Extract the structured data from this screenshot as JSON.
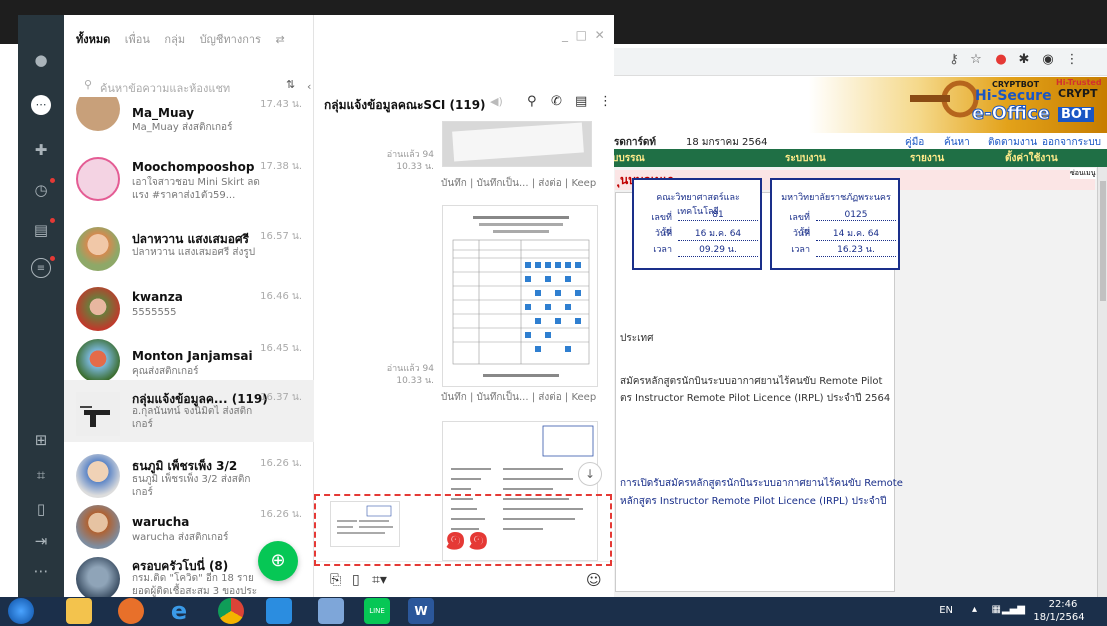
{
  "browser": {
    "banner": {
      "cryptbot": "CRYPTBOT",
      "hi_trusted": "Hi-Trusted",
      "crypt": "CRYPT",
      "hi_secure": "Hi-Secure",
      "eoffice": "e-Office",
      "bot": "BOT"
    },
    "info_bar": {
      "page": "รดการ์ดท์",
      "date": "18 มกราคม 2564",
      "help": "คู่มือ",
      "search": "ค้นหา",
      "track": "ติดตามงาน",
      "logout": "ออกจากระบบ"
    },
    "menu": [
      "บบรรณ",
      "ระบบงาน",
      "รายงาน",
      "ตั้งค่าใช้งาน"
    ],
    "menu_hide": "ซ่อนเมนู",
    "page_title": "ุนบบลูเนเา",
    "stamp_left": {
      "title": "คณะวิทยาศาสตร์และเทคโนโลยี",
      "no_label": "เลขที่รับ",
      "no": "81",
      "date_label": "วันที่",
      "date": "16 ม.ค. 64",
      "time_label": "เวลา",
      "time": "09.29 น."
    },
    "stamp_right": {
      "title": "มหาวิทยาลัยราชภัฏพระนคร",
      "no_label": "เลขที่รับ",
      "no": "0125",
      "date_label": "วันที่",
      "date": "14 ม.ค. 64",
      "time_label": "เวลา",
      "time": "16.23 น."
    },
    "doc_lines": [
      "ประเทศ",
      "สมัครหลักสูตรนักบินระบบอากาศยานไร้คนขับ Remote Pilot",
      "ตร Instructor Remote Pilot Licence (IRPL) ประจำปี 2564",
      "การเปิดรับสมัครหลักสูตรนักบินระบบอากาศยานไร้คนขับ Remote",
      "หลักสูตร Instructor Remote Pilot Licence (IRPL) ประจำปี"
    ]
  },
  "line": {
    "tabs": [
      "ทั้งหมด",
      "เพื่อน",
      "กลุ่ม",
      "บัญชีทางการ"
    ],
    "search_placeholder": "ค้นหาข้อความและห้องแชท",
    "chats": [
      {
        "name": "Ma_Muay",
        "preview": "Ma_Muay ส่งสติกเกอร์",
        "time": "17.43 น."
      },
      {
        "name": "Moochompooshop",
        "preview": "เอาใจสาวชอบ Mini Skirt ลดแรง #ราคาส่ง1ตัว59...",
        "time": "17.38 น."
      },
      {
        "name": "ปลาหวาน แสงเสมอศรี",
        "preview": "ปลาหวาน แสงเสมอศรี ส่งรูป",
        "time": "16.57 น."
      },
      {
        "name": "kwanza",
        "preview": "5555555",
        "time": "16.46 น."
      },
      {
        "name": "Monton Janjamsai",
        "preview": "คุณส่งสติกเกอร์",
        "time": "16.45 น."
      },
      {
        "name": "กลุ่มแจ้งข้อมูลค... (119)",
        "preview": "อ.กุลนันทน์ จงนิมิตไ ส่งสติกเกอร์",
        "time": "16.37 น."
      },
      {
        "name": "ธนภูมิ เพ็ชรเพ็ง 3/2",
        "preview": "ธนภูมิ เพ็ชรเพ็ง 3/2 ส่งสติกเกอร์",
        "time": "16.26 น."
      },
      {
        "name": "warucha",
        "preview": "warucha ส่งสติกเกอร์",
        "time": "16.26 น."
      },
      {
        "name": "ครอบครัวโบนี่ (8)",
        "preview": "กรม.ติด \"โควิด\" อีก 18 ราย ยอดผู้ติดเชื้อสะสม 3 ของประ",
        "time": ""
      }
    ],
    "chat_window": {
      "title": "กลุ่มแจ้งข้อมูลคณะSCI (119)",
      "read1": "อ่านแล้ว 94",
      "time1": "10.33 น.",
      "read2": "อ่านแล้ว 94",
      "time2": "10.33 น.",
      "actions": "บันทึก | บันทึกเป็น... | ส่งต่อ | Keep",
      "annotation": "๑๑"
    }
  },
  "taskbar": {
    "lang": "EN",
    "time": "22:46",
    "date": "18/1/2564"
  }
}
